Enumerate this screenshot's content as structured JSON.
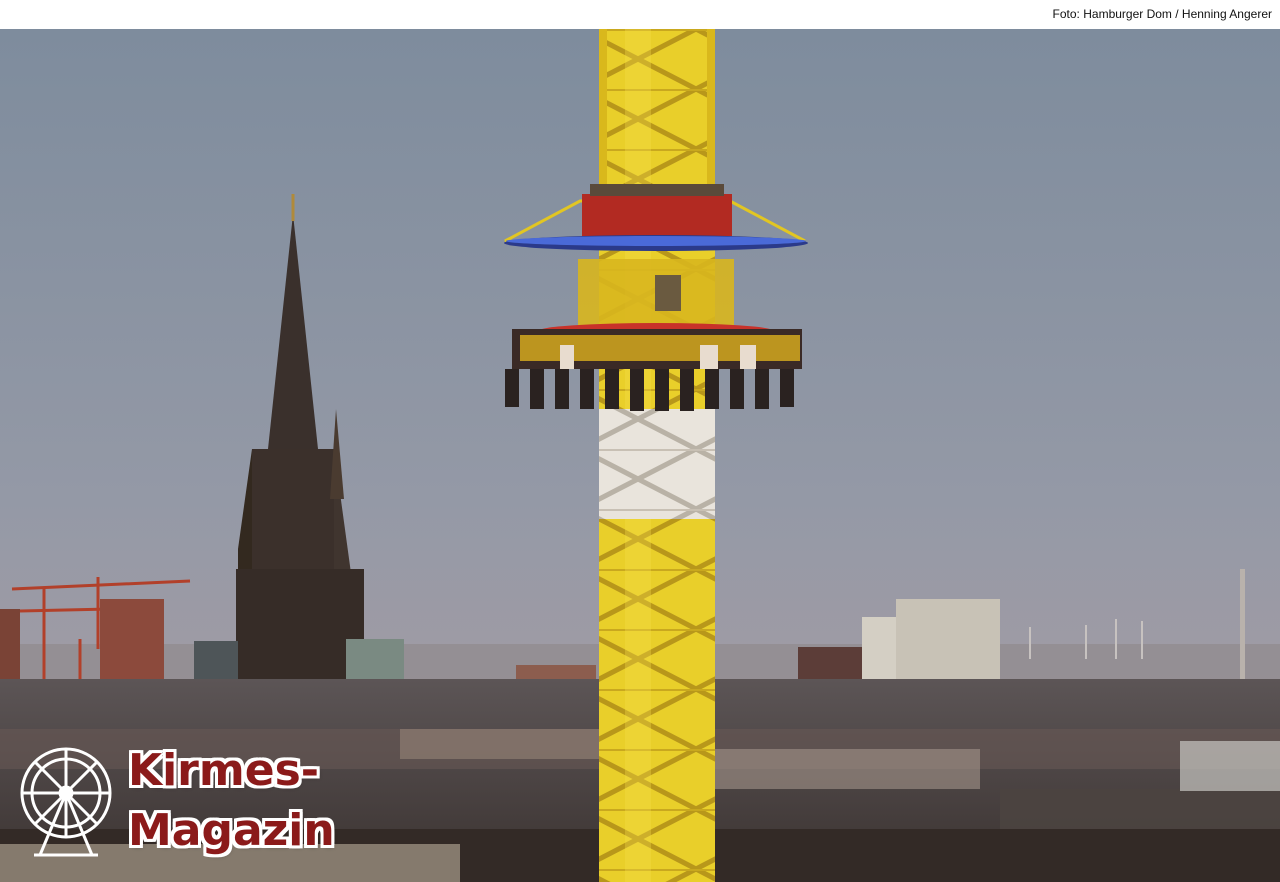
{
  "credit": {
    "text": "Foto: Hamburger Dom / Henning Angerer"
  },
  "logo": {
    "line1": "Kirmes-",
    "line2": "Magazin",
    "icon": "ferris-wheel-icon"
  },
  "colors": {
    "sky_top": "#7f8fa0",
    "sky_bottom": "#a89ba0",
    "tower": "#f0d020",
    "logo_text": "#8b1a1a"
  }
}
